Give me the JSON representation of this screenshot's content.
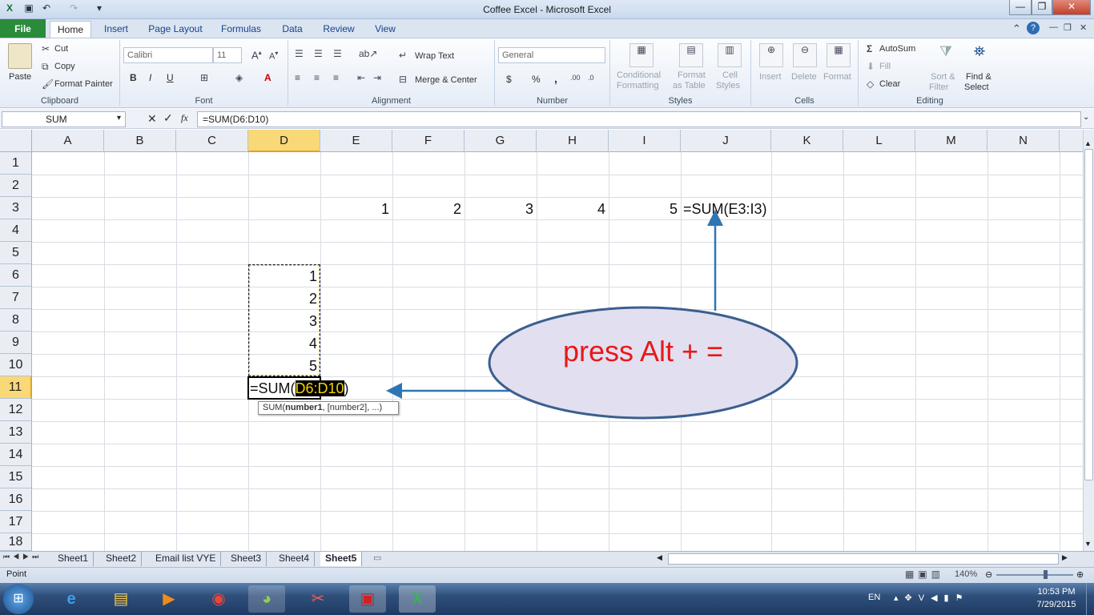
{
  "window": {
    "title": "Coffee Excel  -  Microsoft Excel",
    "buttons": {
      "minimize": "—",
      "restore": "❐",
      "close": "✕"
    }
  },
  "menu": {
    "file": "File",
    "tabs": [
      "Home",
      "Insert",
      "Page Layout",
      "Formulas",
      "Data",
      "Review",
      "View"
    ]
  },
  "ribbon": {
    "clipboard": {
      "label": "Clipboard",
      "paste": "Paste",
      "cut": "Cut",
      "copy": "Copy",
      "format_painter": "Format Painter"
    },
    "font": {
      "label": "Font",
      "name": "Calibri",
      "size": "11",
      "bold": "B",
      "italic": "I",
      "underline": "U"
    },
    "alignment": {
      "label": "Alignment",
      "wrap_text": "Wrap Text",
      "merge_center": "Merge & Center"
    },
    "number": {
      "label": "Number",
      "format": "General",
      "currency": "$",
      "percent": "%",
      "comma": ","
    },
    "styles": {
      "label": "Styles",
      "conditional": "Conditional",
      "formatting": "Formatting",
      "format_as": "Format",
      "table": "as Table",
      "cell": "Cell",
      "cell_styles": "Styles"
    },
    "cells": {
      "label": "Cells",
      "insert": "Insert",
      "delete": "Delete",
      "format": "Format"
    },
    "editing": {
      "label": "Editing",
      "autosum": "AutoSum",
      "fill": "Fill",
      "clear": "Clear",
      "sort": "Sort &",
      "filter": "Filter",
      "find": "Find &",
      "select": "Select"
    }
  },
  "formula_bar": {
    "name_box": "SUM",
    "fx": "fx",
    "formula": "=SUM(D6:D10)"
  },
  "grid": {
    "columns": [
      "A",
      "B",
      "C",
      "D",
      "E",
      "F",
      "G",
      "H",
      "I",
      "J",
      "K",
      "L",
      "M",
      "N"
    ],
    "rows": [
      "1",
      "2",
      "3",
      "4",
      "5",
      "6",
      "7",
      "8",
      "9",
      "10",
      "11",
      "12",
      "13",
      "14",
      "15",
      "16",
      "17",
      "18"
    ],
    "row3_values": [
      "1",
      "2",
      "3",
      "4",
      "5"
    ],
    "j3_formula": "=SUM(E3:I3)",
    "d_values": [
      "1",
      "2",
      "3",
      "4",
      "5"
    ],
    "d11_prefix": "=SUM(",
    "d11_range": "D6:D10",
    "d11_suffix": ")",
    "tooltip_func": "SUM(",
    "tooltip_arg1": "number1",
    "tooltip_rest": ", [number2], ...)"
  },
  "callout": {
    "text": "press Alt + ="
  },
  "sheets": [
    "Sheet1",
    "Sheet2",
    "Email list VYE",
    "Sheet3",
    "Sheet4",
    "Sheet5"
  ],
  "active_sheet": "Sheet5",
  "status": {
    "mode": "Point",
    "zoom": "140%"
  },
  "taskbar": {
    "lang": "EN",
    "time": "10:53 PM",
    "date": "7/29/2015"
  },
  "colors": {
    "accent": "#217346",
    "selection": "#f8d74a",
    "callout_fill": "#e2dff0",
    "callout_border": "#3a5f8f",
    "callout_text": "#e81818",
    "arrow": "#2e75b6"
  }
}
